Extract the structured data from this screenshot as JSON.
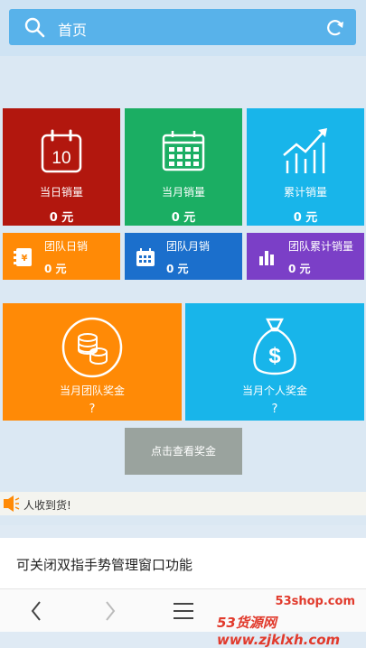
{
  "header": {
    "title": "首页"
  },
  "tiles": {
    "today_sales": {
      "label": "当日销量",
      "value": "0 元",
      "icon_text": "10"
    },
    "month_sales": {
      "label": "当月销量",
      "value": "0 元"
    },
    "total_sales": {
      "label": "累计销量",
      "value": "0 元"
    },
    "team_daily": {
      "label": "团队日销",
      "value": "0 元"
    },
    "team_monthly": {
      "label": "团队月销",
      "value": "0 元"
    },
    "team_total": {
      "label": "团队累计销量",
      "value": "0 元"
    },
    "team_bonus": {
      "label": "当月团队奖金",
      "value": "?"
    },
    "personal_bonus": {
      "label": "当月个人奖金",
      "value": "?"
    }
  },
  "bonus_button": {
    "label": "点击查看奖金"
  },
  "ticker": {
    "text": "人收到货!"
  },
  "popup": {
    "text": "可关闭双指手势管理窗口功能"
  },
  "watermark": {
    "line1": "53shop.com",
    "line2": "53货源网 www.zjklxh.com"
  },
  "icons": [
    "search-icon",
    "refresh-icon",
    "calendar-icon",
    "month-calendar-icon",
    "trend-chart-icon",
    "ledger-icon",
    "small-calendar-icon",
    "bar-chart-icon",
    "coins-icon",
    "money-bag-icon",
    "speaker-icon",
    "back-icon",
    "forward-icon",
    "menu-icon"
  ],
  "colors": {
    "accent": "#58b2ea",
    "red": "#b2170e",
    "green": "#1bae63",
    "cyan": "#18b5ea",
    "orange": "#ff8a06",
    "blue": "#1b6fcc",
    "purple": "#7b3fc7"
  }
}
